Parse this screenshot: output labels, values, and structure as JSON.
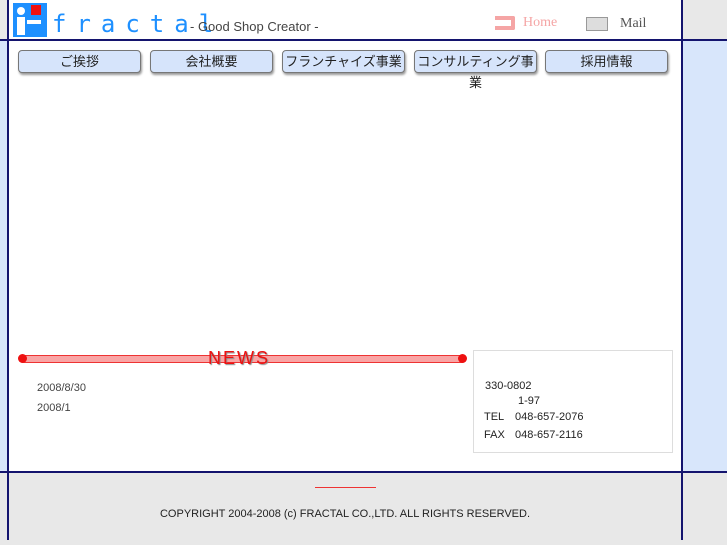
{
  "header": {
    "brand": "fractal",
    "tagline": "- Good Shop Creator -",
    "home_label": "Home",
    "mail_label": "Mail"
  },
  "nav": [
    "ご挨拶",
    "会社概要",
    "フランチャイズ事業",
    "コンサルティング事業",
    "採用情報"
  ],
  "news": {
    "title": "NEWS",
    "items": [
      "2008/8/30",
      "2008/1"
    ]
  },
  "company": {
    "zip": "330-0802",
    "address": "1-97",
    "tel_label": "TEL",
    "tel": "048-657-2076",
    "fax_label": "FAX",
    "fax": "048-657-2116"
  },
  "footer": {
    "copyright": "COPYRIGHT 2004-2008 (c) FRACTAL CO.,LTD. ALL RIGHTS RESERVED."
  }
}
